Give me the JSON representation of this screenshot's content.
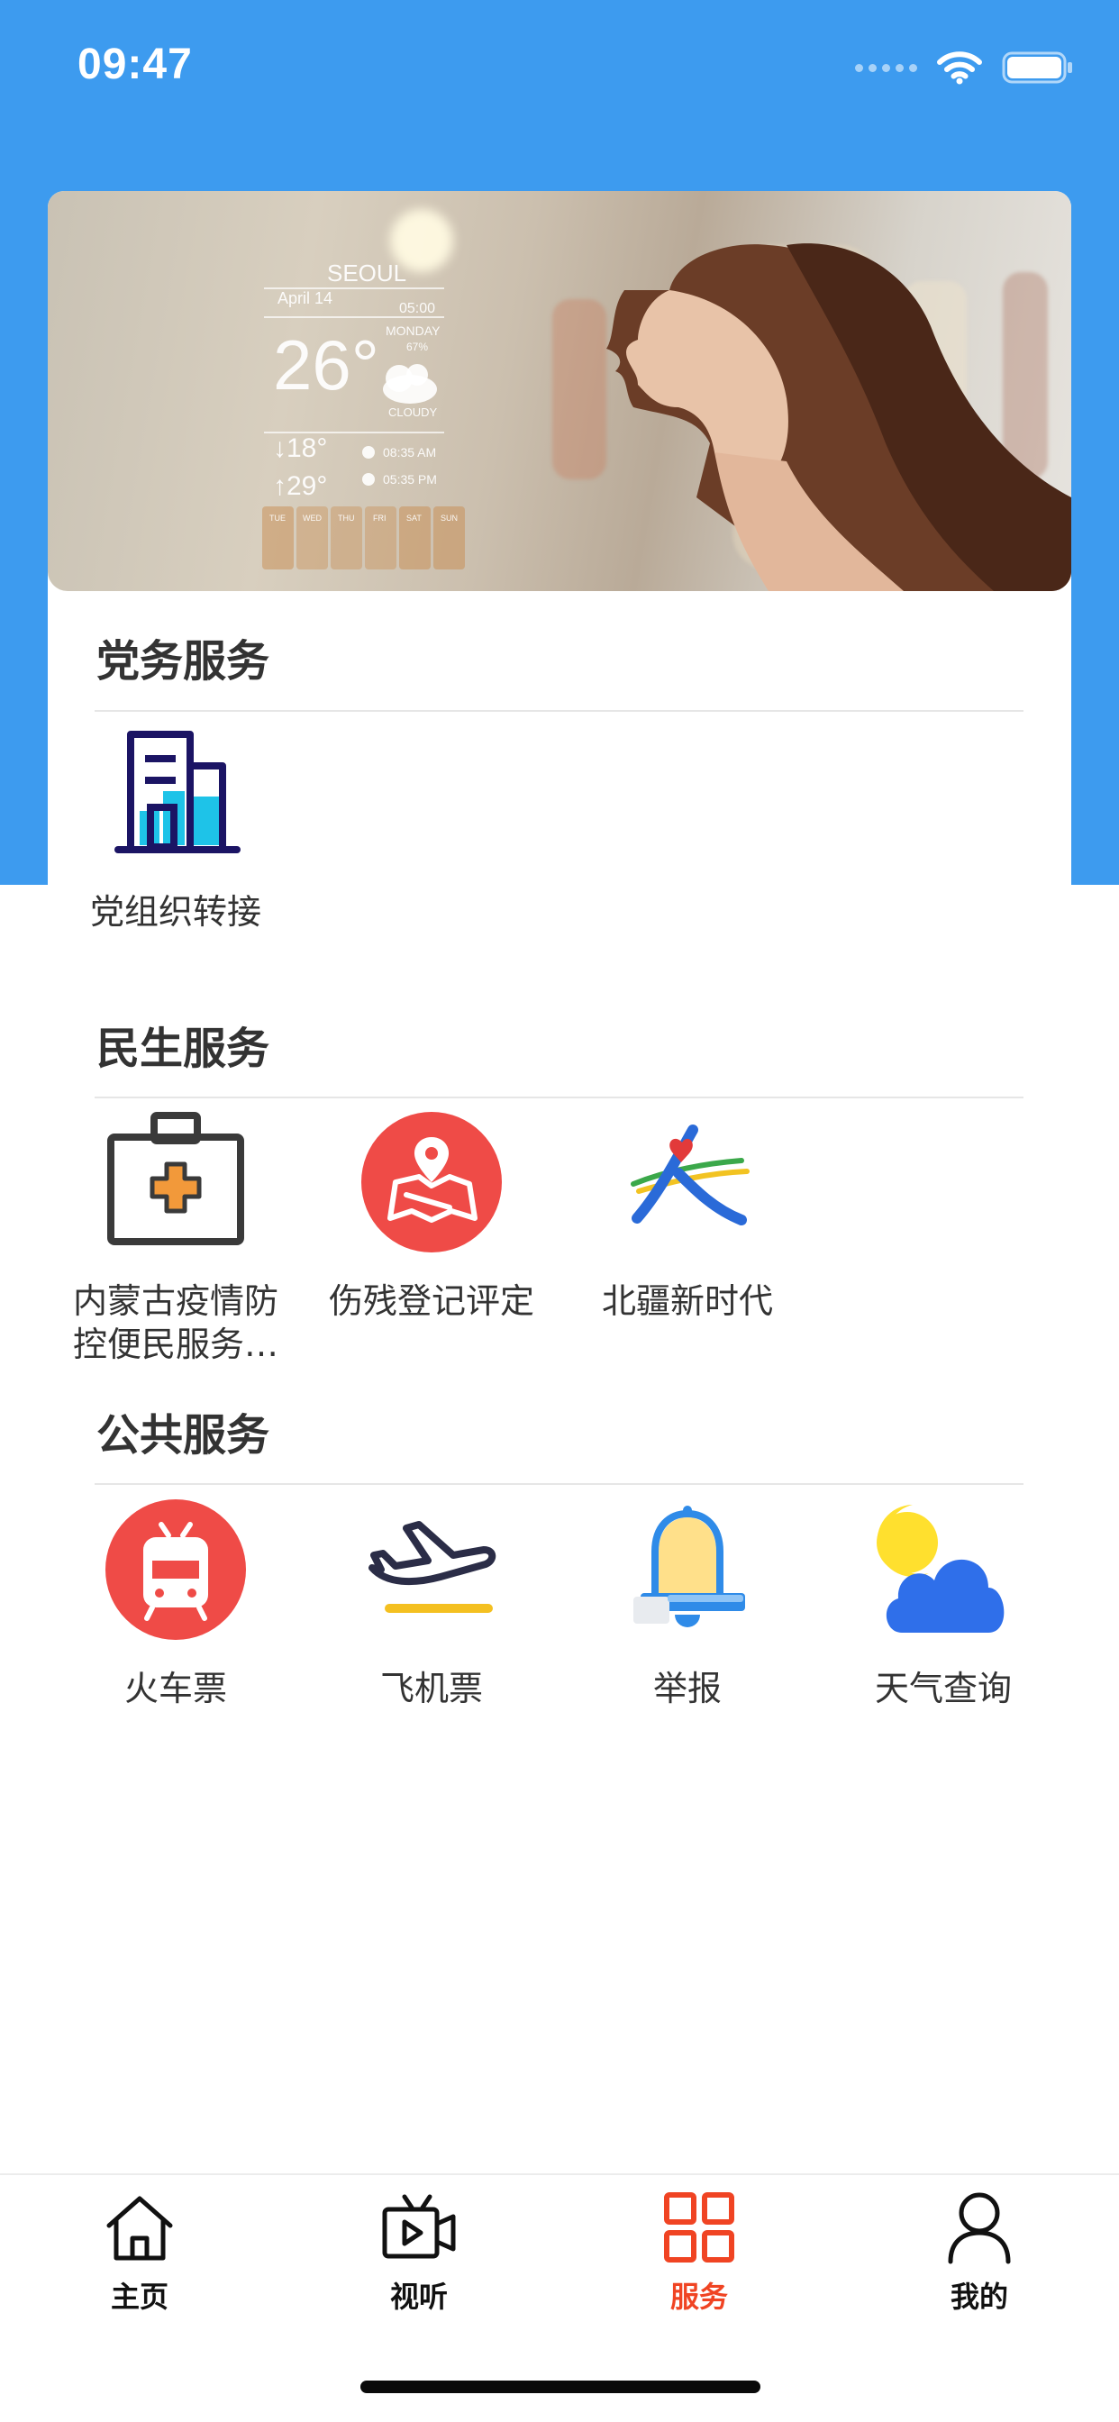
{
  "status": {
    "time": "09:47"
  },
  "banner": {
    "city": "SEOUL",
    "date": "April 14",
    "time_top": "05:00",
    "day": "MONDAY",
    "percent": "67%",
    "temperature": "26°",
    "condition": "CLOUDY",
    "low": "↓18°",
    "high": "↑29°",
    "sunrise": "08:35 AM",
    "sunset": "05:35 PM",
    "days": [
      "TUE",
      "WED",
      "THU",
      "FRI",
      "SAT",
      "SUN"
    ]
  },
  "sections": {
    "party": {
      "title": "党务服务",
      "items": [
        {
          "label": "党组织转接",
          "icon": "office-building-icon"
        }
      ]
    },
    "livelihood": {
      "title": "民生服务",
      "items": [
        {
          "label": "内蒙古疫情防控便民服务…",
          "icon": "medical-kit-icon"
        },
        {
          "label": "伤残登记评定",
          "icon": "map-location-icon"
        },
        {
          "label": "北疆新时代",
          "icon": "beijiang-logo-icon"
        }
      ]
    },
    "public": {
      "title": "公共服务",
      "items": [
        {
          "label": "火车票",
          "icon": "train-icon"
        },
        {
          "label": "飞机票",
          "icon": "airplane-icon"
        },
        {
          "label": "举报",
          "icon": "bell-icon"
        },
        {
          "label": "天气查询",
          "icon": "weather-icon"
        }
      ]
    }
  },
  "tabbar": {
    "active_color": "#f04423",
    "items": [
      {
        "label": "主页",
        "icon": "home-icon"
      },
      {
        "label": "视听",
        "icon": "video-icon"
      },
      {
        "label": "服务",
        "icon": "grid-icon"
      },
      {
        "label": "我的",
        "icon": "user-icon"
      }
    ]
  },
  "colors": {
    "header": "#3d9bef",
    "accent": "#f04423"
  }
}
